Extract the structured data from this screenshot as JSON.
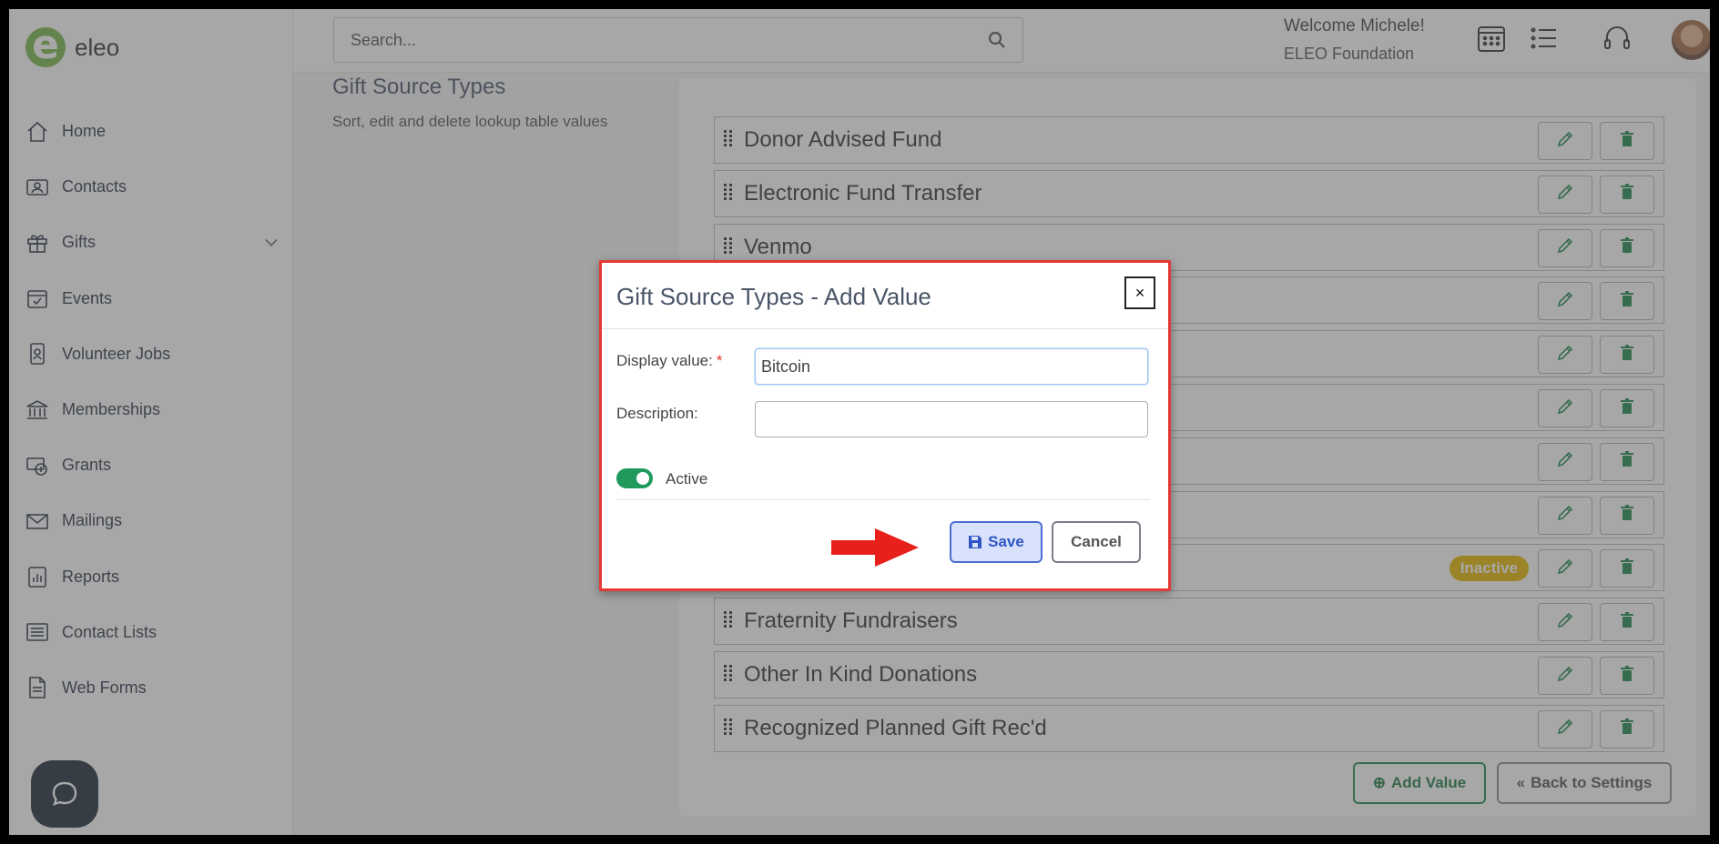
{
  "app": {
    "logo_text": "eleo"
  },
  "sidebar": {
    "items": [
      {
        "label": "Home",
        "icon": "home-icon"
      },
      {
        "label": "Contacts",
        "icon": "contact-card-icon"
      },
      {
        "label": "Gifts",
        "icon": "gift-icon",
        "expandable": true
      },
      {
        "label": "Events",
        "icon": "calendar-check-icon"
      },
      {
        "label": "Volunteer Jobs",
        "icon": "badge-icon"
      },
      {
        "label": "Memberships",
        "icon": "bank-icon"
      },
      {
        "label": "Grants",
        "icon": "money-icon"
      },
      {
        "label": "Mailings",
        "icon": "envelope-icon"
      },
      {
        "label": "Reports",
        "icon": "report-icon"
      },
      {
        "label": "Contact Lists",
        "icon": "list-icon"
      },
      {
        "label": "Web Forms",
        "icon": "document-icon"
      }
    ]
  },
  "header": {
    "search_placeholder": "Search...",
    "welcome": "Welcome Michele!",
    "organization": "ELEO Foundation"
  },
  "page": {
    "title": "Gift Source Types",
    "subtitle": "Sort, edit and delete lookup table values",
    "rows": [
      {
        "label": "Donor Advised Fund",
        "inactive": false
      },
      {
        "label": "Electronic Fund Transfer",
        "inactive": false
      },
      {
        "label": "Venmo",
        "inactive": false
      },
      {
        "label": "",
        "inactive": false
      },
      {
        "label": "",
        "inactive": false
      },
      {
        "label": "",
        "inactive": false
      },
      {
        "label": "",
        "inactive": false
      },
      {
        "label": "",
        "inactive": false
      },
      {
        "label": "",
        "inactive": true
      },
      {
        "label": "Fraternity Fundraisers",
        "inactive": false
      },
      {
        "label": "Other In Kind Donations",
        "inactive": false
      },
      {
        "label": "Recognized Planned Gift Rec'd",
        "inactive": false
      }
    ],
    "inactive_badge": "Inactive",
    "add_value_label": "Add Value",
    "back_label": "Back to Settings"
  },
  "modal": {
    "title": "Gift Source Types - Add Value",
    "close_label": "×",
    "display_value_label": "Display value:",
    "required_mark": "*",
    "display_value": "Bitcoin",
    "description_label": "Description:",
    "description_value": "",
    "active_label": "Active",
    "active": true,
    "save_label": "Save",
    "cancel_label": "Cancel"
  },
  "colors": {
    "brand_green": "#7ab648",
    "action_green": "#1f8a4c",
    "inactive_badge": "#e6b800",
    "highlight_red": "#e53935",
    "save_blue": "#2f56c4"
  }
}
